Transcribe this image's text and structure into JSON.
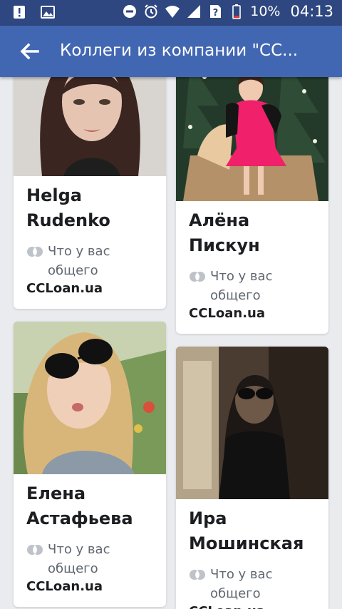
{
  "status_bar": {
    "battery": "10%",
    "time": "04:13"
  },
  "app_bar": {
    "title": "Коллеги из компании \"CC..."
  },
  "people": [
    {
      "name": "Helga Rudenko",
      "mutual": "Что у вас общего",
      "company": "CCLoan.ua"
    },
    {
      "name": "Алёна Пискун",
      "mutual": "Что у вас общего",
      "company": "CCLoan.ua"
    },
    {
      "name": "Елена Астафьева",
      "mutual": "Что у вас общего",
      "company": "CCLoan.ua"
    },
    {
      "name": "Ира Мошинская",
      "mutual": "Что у вас общего",
      "company": "CCLoan.ua"
    }
  ],
  "colors": {
    "status_bar": "#2f4780",
    "app_bar": "#4267b2",
    "background": "#e9ebee"
  }
}
